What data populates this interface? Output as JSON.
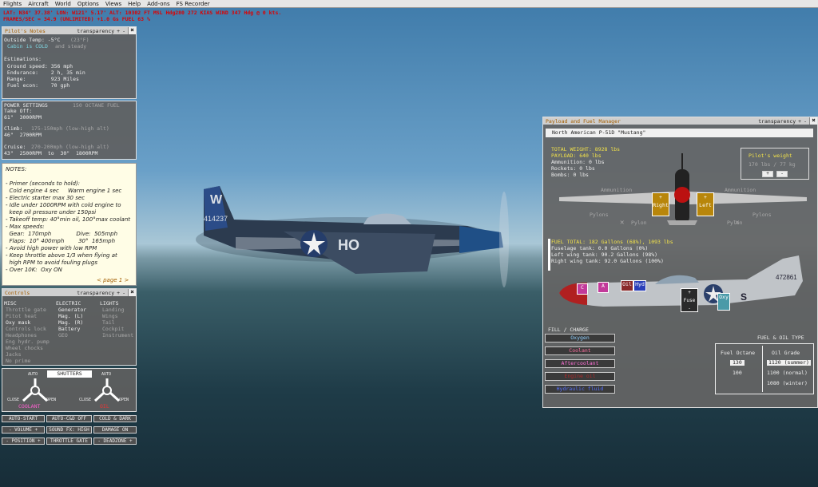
{
  "menu": [
    "Flights",
    "Aircraft",
    "World",
    "Options",
    "Views",
    "Help",
    "Add-ons",
    "FS Recorder"
  ],
  "hud": {
    "line1": "LAT: N34° 37.38'  LON: W121° 5.17'  ALT: 10302 FT  MSL   Hdg280  272 KIAS   WIND 347 Hdg @ 0 kts.",
    "line2": "FRAMES/SEC = 34.9  (UNLIMITED)  +1.0 Gs  FUEL 63 %"
  },
  "pilot_notes": {
    "title": "Pilot's Notes",
    "transparency": "transparency",
    "plus": "+",
    "minus": "-",
    "temp_label": "Outside Temp: -5°C",
    "temp_f": "(23°F)",
    "cabin_a": "Cabin is COLD",
    "cabin_b": "and steady",
    "est_title": "Estimations:",
    "ground": " Ground speed: 356 mph",
    "endurance": " Endurance:    2 h, 35 min",
    "range": " Range:        923 Miles",
    "fuel": " Fuel econ:    70 gph",
    "power_title": "POWER SETTINGS",
    "octane": "150 OCTANE FUEL",
    "takeoff": "Take Off:",
    "takeoff_v": "61\"  3000RPM",
    "climb": "Climb:",
    "climb_v": "46\"  2700RPM",
    "climb_d": "175-150mph (low-high alt)",
    "cruise": "Cruise:",
    "cruise_d": "270-200mph (low-high alt)",
    "cruise_v": "43\"  2500RPM  to  30\"  1800RPM"
  },
  "notes": {
    "lines": [
      "NOTES:",
      "- Primer (seconds to hold):",
      "  Cold engine 4 sec     Warm engine 1 sec",
      "- Electric starter max 30 sec",
      "- Idle under 1000RPM with cold engine to",
      "  keep oil pressure under 150psi",
      "- Takeoff temp: 40°min oil, 100°max coolant",
      "- Max speeds:",
      "  Gear:  170mph              Dive:  505mph",
      "  Flaps:  10° 400mph        30°  165mph",
      "- Avoid high power with low RPM",
      "- Keep throttle above 1/3 when flying at",
      "  high RPM to avoid fouling plugs",
      "- Over 10K:  Oxy ON"
    ],
    "page": "< page 1 >"
  },
  "controls": {
    "title": "Controls",
    "transparency": "transparency",
    "misc_h": "MISC",
    "misc": [
      "Throttle gate",
      "Pitot heat",
      "Oxy mask",
      "Controls lock",
      "Headphones",
      "Eng hydr. pump",
      "Wheel chocks",
      "Jacks",
      "No prime"
    ],
    "misc_on": [
      false,
      false,
      true,
      false,
      false,
      false,
      false,
      false,
      false
    ],
    "elec_h": "ELECTRIC",
    "elec": [
      "Generator",
      "Mag. (L)",
      "Mag. (R)",
      "Battery",
      "GEO"
    ],
    "elec_on": [
      true,
      true,
      true,
      true,
      false
    ],
    "lights_h": "LIGHTS",
    "lights": [
      "Landing",
      "Wings",
      "Tail",
      "Cockpit",
      "Instrument"
    ]
  },
  "shutters": {
    "title": "SHUTTERS",
    "auto": "AUTO",
    "close": "CLOSE",
    "open": "OPEN",
    "coolant": "COOLANT",
    "oil": "OIL"
  },
  "buttons": {
    "auto_start": "AUTO-START",
    "auto_cd": "AUTO-C&D OFF",
    "cold_dark": "COLD & DARK",
    "volume": "-  VOLUME  +",
    "sound": "SOUND FX: HIGH",
    "damage": "DAMAGE ON",
    "position": "- POSITION +",
    "throttle": "THROTTLE GATE",
    "deadzone": "- DEADZONE +"
  },
  "fuel": {
    "title": "Payload and Fuel Manager",
    "transparency": "transparency",
    "aircraft": "North American P-51D \"Mustang\"",
    "total_weight": "TOTAL WEIGHT: 8928 lbs",
    "payload": "PAYLOAD: 640 lbs",
    "ammo": "Ammunition: 0 lbs",
    "rockets": "Rockets: 0 lbs",
    "bombs": "Bombs: 0 lbs",
    "pilot_weight_title": "Pilot's weight",
    "pilot_weight": "170 lbs / 77 kg",
    "ammunition": "Ammunition",
    "right": "Right",
    "left": "Left",
    "pylons": "Pylons",
    "pylon": "Pylon",
    "fuel_total": "FUEL TOTAL: 182 Gallons (68%), 1093 lbs",
    "fuselage": "Fuselage tank: 0.0 Gallons (0%)",
    "left_tank": "Left wing tank: 90.2 Gallons (98%)",
    "right_tank": "Right wing tank: 92.0 Gallons (100%)",
    "tanks": {
      "c": "C",
      "a": "A",
      "oil": "Oil",
      "hyd": "Hyd",
      "fuse": "Fuse",
      "oxy": "Oxy"
    },
    "fill_title": "FILL / CHARGE",
    "fill": [
      {
        "label": "Oxygen",
        "color": "#8fd0ff"
      },
      {
        "label": "Coolant",
        "color": "#ff6fa0"
      },
      {
        "label": "Aftercoolant",
        "color": "#ff6fd8"
      },
      {
        "label": "Engine oil",
        "color": "#b02828"
      },
      {
        "label": "Hydraulic fluid",
        "color": "#2a3fb8"
      }
    ],
    "fuel_oil_title": "FUEL & OIL TYPE",
    "octane_h": "Fuel Octane",
    "grade_h": "Oil Grade",
    "octanes": [
      "130",
      "100"
    ],
    "grades": [
      "1120 (summer)",
      "1100 (normal)",
      "1080 (winter)"
    ]
  },
  "plane": {
    "code_a": "W",
    "code_b": "414237",
    "code_c": "HO",
    "side_code": "472861",
    "side_letter": "S"
  }
}
